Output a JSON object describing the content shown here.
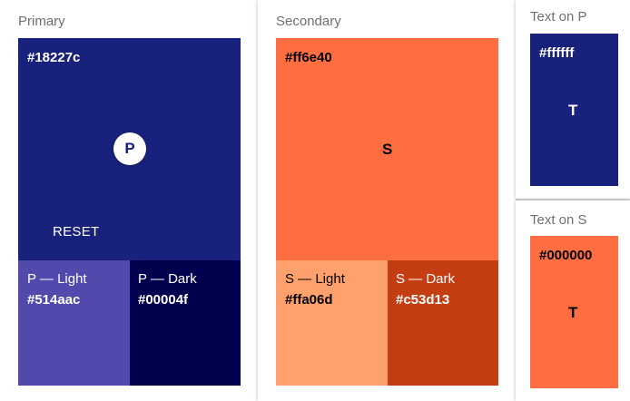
{
  "primary": {
    "title": "Primary",
    "main_hex": "#18227c",
    "fab_letter": "P",
    "button_label": "RESET",
    "light_label": "P — Light",
    "light_hex": "#514aac",
    "dark_label": "P — Dark",
    "dark_hex": "#00004f"
  },
  "secondary": {
    "title": "Secondary",
    "main_hex": "#ff6e40",
    "letter": "S",
    "light_label": "S — Light",
    "light_hex": "#ffa06d",
    "dark_label": "S — Dark",
    "dark_hex": "#c53d13"
  },
  "text_on_p": {
    "title": "Text on P",
    "hex": "#ffffff",
    "letter": "T"
  },
  "text_on_s": {
    "title": "Text on S",
    "hex": "#000000",
    "letter": "T"
  },
  "colors": {
    "primary": "#18227c",
    "primary_light": "#514aac",
    "primary_dark": "#00004f",
    "secondary": "#ff6e40",
    "secondary_light": "#ffa06d",
    "secondary_dark": "#c53d13",
    "text_on_primary": "#ffffff",
    "text_on_secondary": "#000000"
  }
}
